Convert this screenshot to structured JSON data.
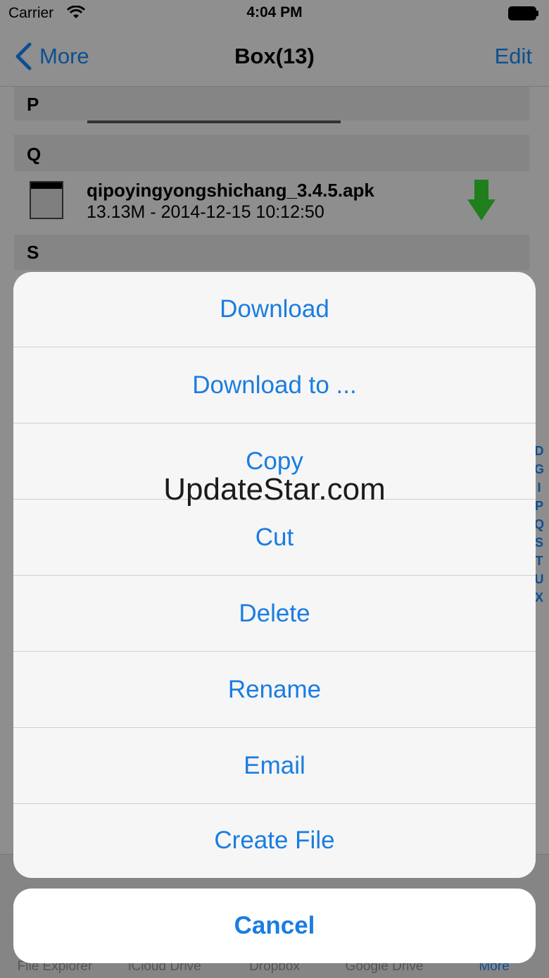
{
  "status_bar": {
    "carrier": "Carrier",
    "time": "4:04 PM"
  },
  "nav": {
    "back_label": "More",
    "title": "Box(13)",
    "edit_label": "Edit"
  },
  "list": {
    "sections": [
      "P",
      "Q",
      "S"
    ],
    "file": {
      "name": "qipoyingyongshichang_3.4.5.apk",
      "meta": "13.13M - 2014-12-15 10:12:50"
    },
    "index_letters": [
      "D",
      "G",
      "I",
      "P",
      "Q",
      "S",
      "T",
      "U",
      "X"
    ]
  },
  "tab_bar": {
    "items": [
      "File Explorer",
      "iCloud Drive",
      "Dropbox",
      "Google Drive",
      "More"
    ]
  },
  "action_sheet": {
    "items": [
      "Download",
      "Download to ...",
      "Copy",
      "Cut",
      "Delete",
      "Rename",
      "Email",
      "Create File"
    ],
    "cancel": "Cancel"
  },
  "watermark": "UpdateStar.com",
  "colors": {
    "accent": "#1a7de0",
    "dim_background": "#8e8e8e",
    "download_arrow": "#2fa82a"
  }
}
